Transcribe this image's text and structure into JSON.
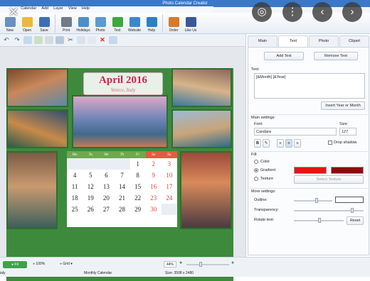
{
  "window": {
    "title": "Photo Calendar Creator"
  },
  "menu": [
    "Calendar",
    "Add",
    "Layer",
    "View",
    "Help"
  ],
  "toolbar": [
    {
      "label": "New",
      "icon": "new-doc-icon",
      "color": "#6a8fbf"
    },
    {
      "label": "Open",
      "icon": "folder-icon",
      "color": "#e8b93c"
    },
    {
      "label": "Save",
      "icon": "save-icon",
      "color": "#3d6fb3"
    },
    {
      "label": "Print",
      "icon": "printer-icon",
      "color": "#6f7b88"
    },
    {
      "label": "Holidays",
      "icon": "holidays-icon",
      "color": "#4e8fc7"
    },
    {
      "label": "Photo",
      "icon": "photo-icon",
      "color": "#5b9ad2"
    },
    {
      "label": "Text",
      "icon": "text-icon",
      "color": "#3da83d"
    },
    {
      "label": "Website",
      "icon": "globe-icon",
      "color": "#3c86cf"
    },
    {
      "label": "Help",
      "icon": "help-icon",
      "color": "#2d7fc6"
    },
    {
      "label": "Order",
      "icon": "order-icon",
      "color": "#d77a2a"
    },
    {
      "label": "Like Us",
      "icon": "like-icon",
      "color": "#3b5998"
    }
  ],
  "overlay_buttons": [
    {
      "name": "lens-icon",
      "glyph": "◎"
    },
    {
      "name": "more-icon",
      "glyph": "⋮"
    },
    {
      "name": "prev-icon",
      "glyph": "‹"
    },
    {
      "name": "next-icon",
      "glyph": "›"
    }
  ],
  "close_glyph": "✕",
  "calendar": {
    "title": "April 2016",
    "subtitle": "Venice, Italy",
    "weekdays": [
      "Mo",
      "Tu",
      "We",
      "Th",
      "Fr",
      "Sa",
      "Su"
    ],
    "weeks": [
      [
        "",
        "",
        "",
        "",
        "1",
        "2",
        "3"
      ],
      [
        "4",
        "5",
        "6",
        "7",
        "8",
        "9",
        "10"
      ],
      [
        "11",
        "12",
        "13",
        "14",
        "15",
        "16",
        "17"
      ],
      [
        "18",
        "19",
        "20",
        "21",
        "22",
        "23",
        "24"
      ],
      [
        "25",
        "26",
        "27",
        "28",
        "29",
        "30",
        ""
      ]
    ]
  },
  "panel": {
    "tabs": [
      "Main",
      "Text",
      "Photo",
      "Clipart"
    ],
    "active_tab": "Text",
    "add_text": "Add Text",
    "remove_text": "Remove Text",
    "text_label": "Text:",
    "text_value": "[&Month] [&Year]",
    "insert_btn": "Insert Year or Month",
    "main_settings": "Main settings:",
    "font_label": "Font:",
    "font_value": "Candara",
    "size_label": "Size:",
    "size_value": "127",
    "drop_shadow": "Drop shadow",
    "fill_label": "Fill:",
    "fill_color": "Color",
    "fill_gradient": "Gradient",
    "fill_texture": "Texture",
    "select_texture": "Select Texture",
    "gradient_colors": [
      "#e41414",
      "#8a0d0d"
    ],
    "more_settings": "More settings:",
    "outline": "Outline:",
    "transparency": "Transparency:",
    "rotate": "Rotate text:",
    "reset": "Reset"
  },
  "status": {
    "fit": "Fit",
    "zoom100": "100%",
    "grid": "Grid",
    "zoom": "44%",
    "app_left": "ialy",
    "doc": "Monthly Calendar",
    "size": "Size: 3508 x 2480"
  }
}
